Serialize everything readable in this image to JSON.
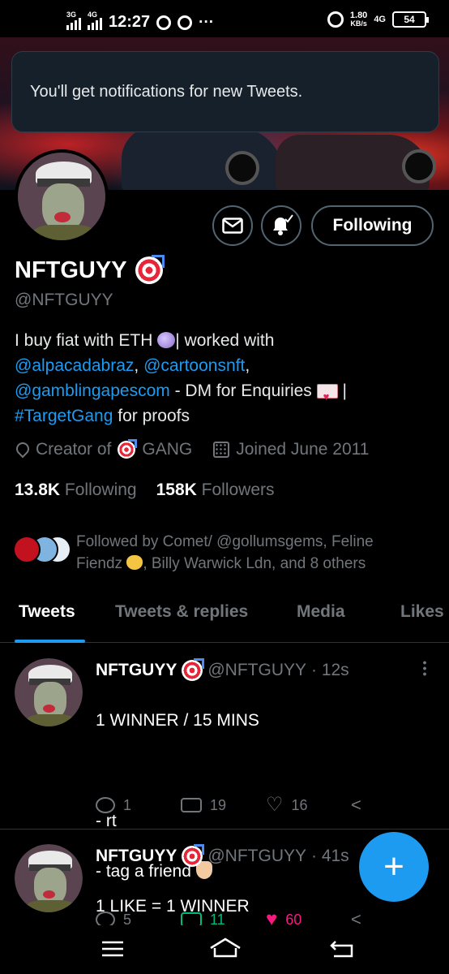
{
  "status_bar": {
    "network_1": "3G",
    "network_2": "4G",
    "time": "12:27",
    "speed_value": "1.80",
    "speed_unit": "KB/s",
    "network_3": "4G",
    "battery": "54"
  },
  "toast": {
    "message": "You'll get notifications for new Tweets."
  },
  "profile": {
    "display_name": "NFTGUYY",
    "handle": "@NFTGUYY",
    "follow_button": "Following",
    "bio": {
      "part1": "I buy fiat with ETH ",
      "part2": "| worked with",
      "link1": "@alpacadabraz",
      "sep1": ", ",
      "link2": "@cartoonsnft",
      "sep2": ",",
      "link3": "@gamblingapescom",
      "part3": " - DM for Enquiries ",
      "part4": " |",
      "hashtag": "#TargetGang",
      "part5": " for proofs"
    },
    "location_prefix": "Creator of",
    "location_suffix": "GANG",
    "joined": "Joined June 2011",
    "following_count": "13.8K",
    "following_label": "Following",
    "followers_count": "158K",
    "followers_label": "Followers",
    "followed_by_line1": "Followed by Comet/ @gollumsgems, Feline",
    "followed_by_line2a": "Fiendz ",
    "followed_by_line2b": ", Billy Warwick Ldn, and 8 others"
  },
  "tabs": [
    {
      "label": "Tweets",
      "active": true
    },
    {
      "label": "Tweets & replies",
      "active": false
    },
    {
      "label": "Media",
      "active": false
    },
    {
      "label": "Likes",
      "active": false
    }
  ],
  "tweets": [
    {
      "name": "NFTGUYY",
      "handle": "@NFTGUYY",
      "time": "· 12s",
      "text_line1": "1 WINNER / 15 MINS",
      "text_line2": "- rt",
      "text_line3": "- tag a friend",
      "replies": "1",
      "retweets": "19",
      "likes": "16"
    },
    {
      "name": "NFTGUYY",
      "handle": "@NFTGUYY",
      "time": "· 41s",
      "text_line1": "1 LIKE = 1 WINNER",
      "replies": "5",
      "retweets": "11",
      "likes": "60"
    }
  ],
  "colors": {
    "accent": "#1d9bf0",
    "retweeted": "#00ba7c",
    "liked": "#f91880",
    "secondary_text": "#71767b"
  }
}
